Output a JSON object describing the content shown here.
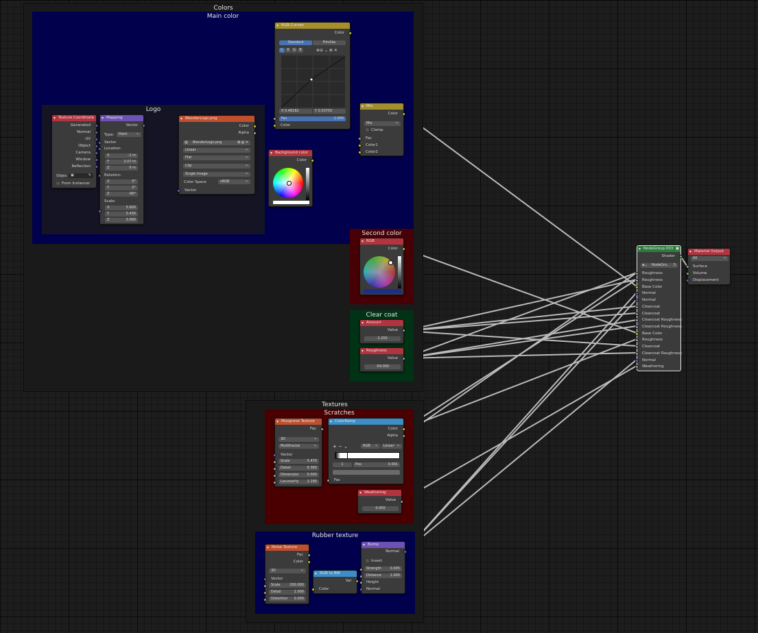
{
  "frames": {
    "colors": "Colors",
    "main_color": "Main color",
    "logo": "Logo",
    "second_color": "Second color",
    "clear_coat": "Clear coat",
    "textures": "Textures",
    "scratches": "Scratches",
    "rubber_texture": "Rubber texture"
  },
  "tex_coord": {
    "title": "Texture Coordinate",
    "outputs": [
      "Generated",
      "Normal",
      "UV",
      "Object",
      "Camera",
      "Window",
      "Reflection"
    ],
    "object_label": "Objec",
    "from_instancer": "From Instancer"
  },
  "mapping": {
    "title": "Mapping",
    "out": "Vector",
    "type_label": "Type:",
    "type_value": "Point",
    "vector": "Vector",
    "location": "Location:",
    "loc": [
      [
        "X",
        "-1 m"
      ],
      [
        "Y",
        "2.07 m"
      ],
      [
        "Z",
        "0 m"
      ]
    ],
    "rotation": "Rotation:",
    "rot": [
      [
        "X",
        "0°"
      ],
      [
        "Y",
        "0°"
      ],
      [
        "Z",
        "-90°"
      ]
    ],
    "scale": "Scale:",
    "scl": [
      [
        "X",
        "5.600"
      ],
      [
        "Y",
        "5.430"
      ],
      [
        "Z",
        "3.000"
      ]
    ]
  },
  "image_tex": {
    "title": "BlenderLogo.png",
    "out_color": "Color",
    "out_alpha": "Alpha",
    "image_name": "BlenderLogo.png",
    "opts": [
      "Linear",
      "Flat",
      "Clip",
      "Single Image"
    ],
    "colorspace_label": "Color Space",
    "colorspace_value": "sRGB",
    "vector": "Vector"
  },
  "rgb_curves": {
    "title": "RGB Curves",
    "out": "Color",
    "tab_standard": "Standard",
    "tab_filmlike": "Filmlike",
    "channels": [
      "C",
      "R",
      "G",
      "B"
    ],
    "x_readout": "X 0.48182",
    "y_readout": "Y 0.53750",
    "fac_label": "Fac",
    "fac_value": "1.000",
    "color_in": "Color"
  },
  "mix": {
    "title": "Mix",
    "out": "Color",
    "mode": "Mix",
    "clamp": "Clamp",
    "inputs": [
      "Fac",
      "Color1",
      "Color2"
    ]
  },
  "bg_color": {
    "title": "Background color",
    "out": "Color"
  },
  "rgb2": {
    "title": "RGB",
    "out": "Color"
  },
  "amount": {
    "title": "Amount",
    "out": "Value",
    "value": "2.200"
  },
  "roughness": {
    "title": "Roughness",
    "out": "Value",
    "value": "-59.000"
  },
  "musgrave": {
    "title": "Musgrave Texture",
    "out": "Fac",
    "dim": "3D",
    "type": "Multifractal",
    "vector": "Vector",
    "params": [
      [
        "Scale",
        "5.470"
      ],
      [
        "Detail",
        "6.360"
      ],
      [
        "Dimension",
        "0.000"
      ],
      [
        "Lacunarity",
        "2.290"
      ]
    ]
  },
  "colorramp": {
    "title": "ColorRamp",
    "out_color": "Color",
    "out_alpha": "Alpha",
    "mode": "RGB",
    "interp": "Linear",
    "index": "1",
    "pos_label": "Pos:",
    "pos_value": "0.091",
    "fac": "Fac"
  },
  "weathering": {
    "title": "Weathering",
    "out": "Value",
    "value": "0.000"
  },
  "noise": {
    "title": "Noise Texture",
    "out_fac": "Fac",
    "out_color": "Color",
    "dim": "3D",
    "vector": "Vector",
    "params": [
      [
        "Scale",
        "200.000"
      ],
      [
        "Detail",
        "1.000"
      ],
      [
        "Distortion",
        "0.000"
      ]
    ]
  },
  "rgb2bw": {
    "title": "RGB to BW",
    "out": "Val",
    "in": "Color"
  },
  "bump": {
    "title": "Bump",
    "out": "Normal",
    "invert": "Invert",
    "params": [
      [
        "Strength",
        "0.005"
      ],
      [
        "Distance",
        "1.000"
      ]
    ],
    "height": "Height",
    "normal": "Normal"
  },
  "group": {
    "title": "NodeGroup.003",
    "out": "Shader",
    "datablock": "NodeGro..",
    "users": "5",
    "inputs": [
      "Roughness",
      "Roughness",
      "Base Color",
      "Normal",
      "Normal",
      "Clearcoat",
      "Clearcoat",
      "Clearcoat Roughness",
      "Clearcoat Roughness",
      "Base Color",
      "Roughness",
      "Clearcoat",
      "Clearcoat Roughness",
      "Normal",
      "Weathering"
    ]
  },
  "output": {
    "title": "Material Output",
    "target": "All",
    "inputs": [
      "Surface",
      "Volume",
      "Displacement"
    ]
  }
}
